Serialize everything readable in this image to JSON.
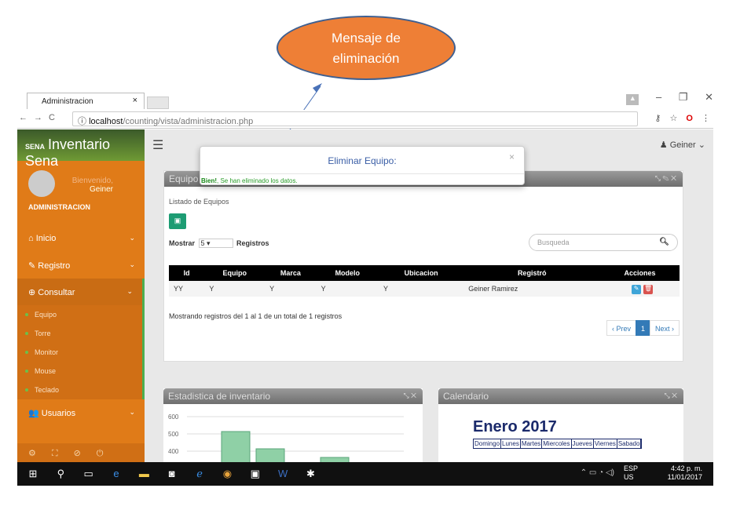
{
  "callout": {
    "line1": "Mensaje de",
    "line2": "eliminación"
  },
  "browser": {
    "tab_title": "Administracion",
    "tab_close": "×",
    "url_host": "localhost",
    "url_path": "/counting/vista/administracion.php",
    "nav_back": "←",
    "nav_forward": "→",
    "nav_reload": "C"
  },
  "sidebar": {
    "brand": "Inventario Sena",
    "logo_text": "SENA",
    "welcome": "Bienvenido,",
    "user_name": "Geiner",
    "role": "ADMINISTRACION",
    "items": [
      {
        "icon": "home-icon",
        "label": "Inicio"
      },
      {
        "icon": "edit-icon",
        "label": "Registro"
      },
      {
        "icon": "search-icon",
        "label": "Consultar"
      },
      {
        "icon": "users-icon",
        "label": "Usuarios"
      }
    ],
    "sub_items": [
      "Equipo",
      "Torre",
      "Monitor",
      "Mouse",
      "Teclado"
    ]
  },
  "topbar": {
    "user_menu": "Geiner"
  },
  "equipo_panel": {
    "title": "Equipo",
    "list_title": "Listado de Equipos",
    "show_label": "Mostrar",
    "show_value": "5",
    "records_label": "Registros",
    "search_placeholder": "Busqueda",
    "columns": [
      "Id",
      "Equipo",
      "Marca",
      "Modelo",
      "Ubicacion",
      "Registró",
      "Acciones"
    ],
    "rows": [
      {
        "id": "YY",
        "equipo": "Y",
        "marca": "Y",
        "modelo": "Y",
        "ubicacion": "Y",
        "registro": "Geiner Ramirez"
      }
    ],
    "info": "Mostrando registros del 1 al 1 de un total de 1 registros",
    "pager_prev": "‹ Prev",
    "pager_current": "1",
    "pager_next": "Next ›"
  },
  "stat_panel": {
    "title": "Estadistica de inventario",
    "y_ticks": [
      "600",
      "500",
      "400"
    ]
  },
  "cal_panel": {
    "title": "Calendario",
    "month": "Enero 2017",
    "days": [
      "Domingo",
      "Lunes",
      "Martes",
      "Miercoles",
      "Jueves",
      "Viernes",
      "Sabado"
    ]
  },
  "modal": {
    "title": "Eliminar Equipo:",
    "close": "×",
    "msg_bold": "Bien!",
    "msg_text": ", Se han eliminado los datos."
  },
  "taskbar": {
    "lang1": "ESP",
    "lang2": "US",
    "time": "4:42 p. m.",
    "date": "11/01/2017"
  }
}
